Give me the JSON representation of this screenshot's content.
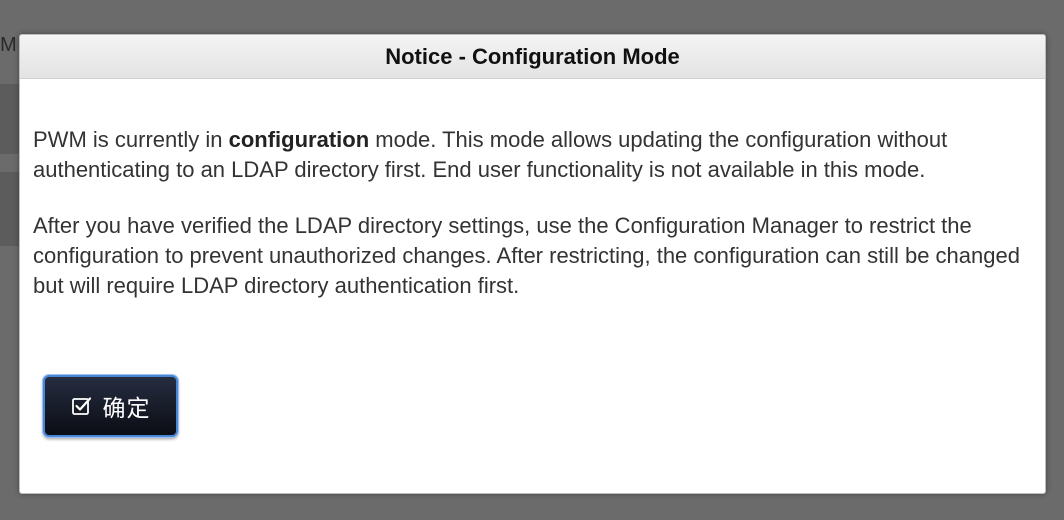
{
  "background": {
    "fragment_text": "M"
  },
  "dialog": {
    "title": "Notice - Configuration Mode",
    "paragraph1": {
      "before": "PWM is currently in ",
      "bold": "configuration",
      "after": " mode. This mode allows updating the configuration without authenticating to an LDAP directory first. End user functionality is not available in this mode."
    },
    "paragraph2": "After you have verified the LDAP directory settings, use the Configuration Manager to restrict the configuration to prevent unauthorized changes. After restricting, the configuration can still be changed but will require LDAP directory authentication first.",
    "ok_button": {
      "label": "确定",
      "icon": "checkbox-check-icon"
    }
  },
  "colors": {
    "overlay": "#6b6b6b",
    "button_bg": "#0b0d14",
    "button_border": "#4a86d6"
  }
}
